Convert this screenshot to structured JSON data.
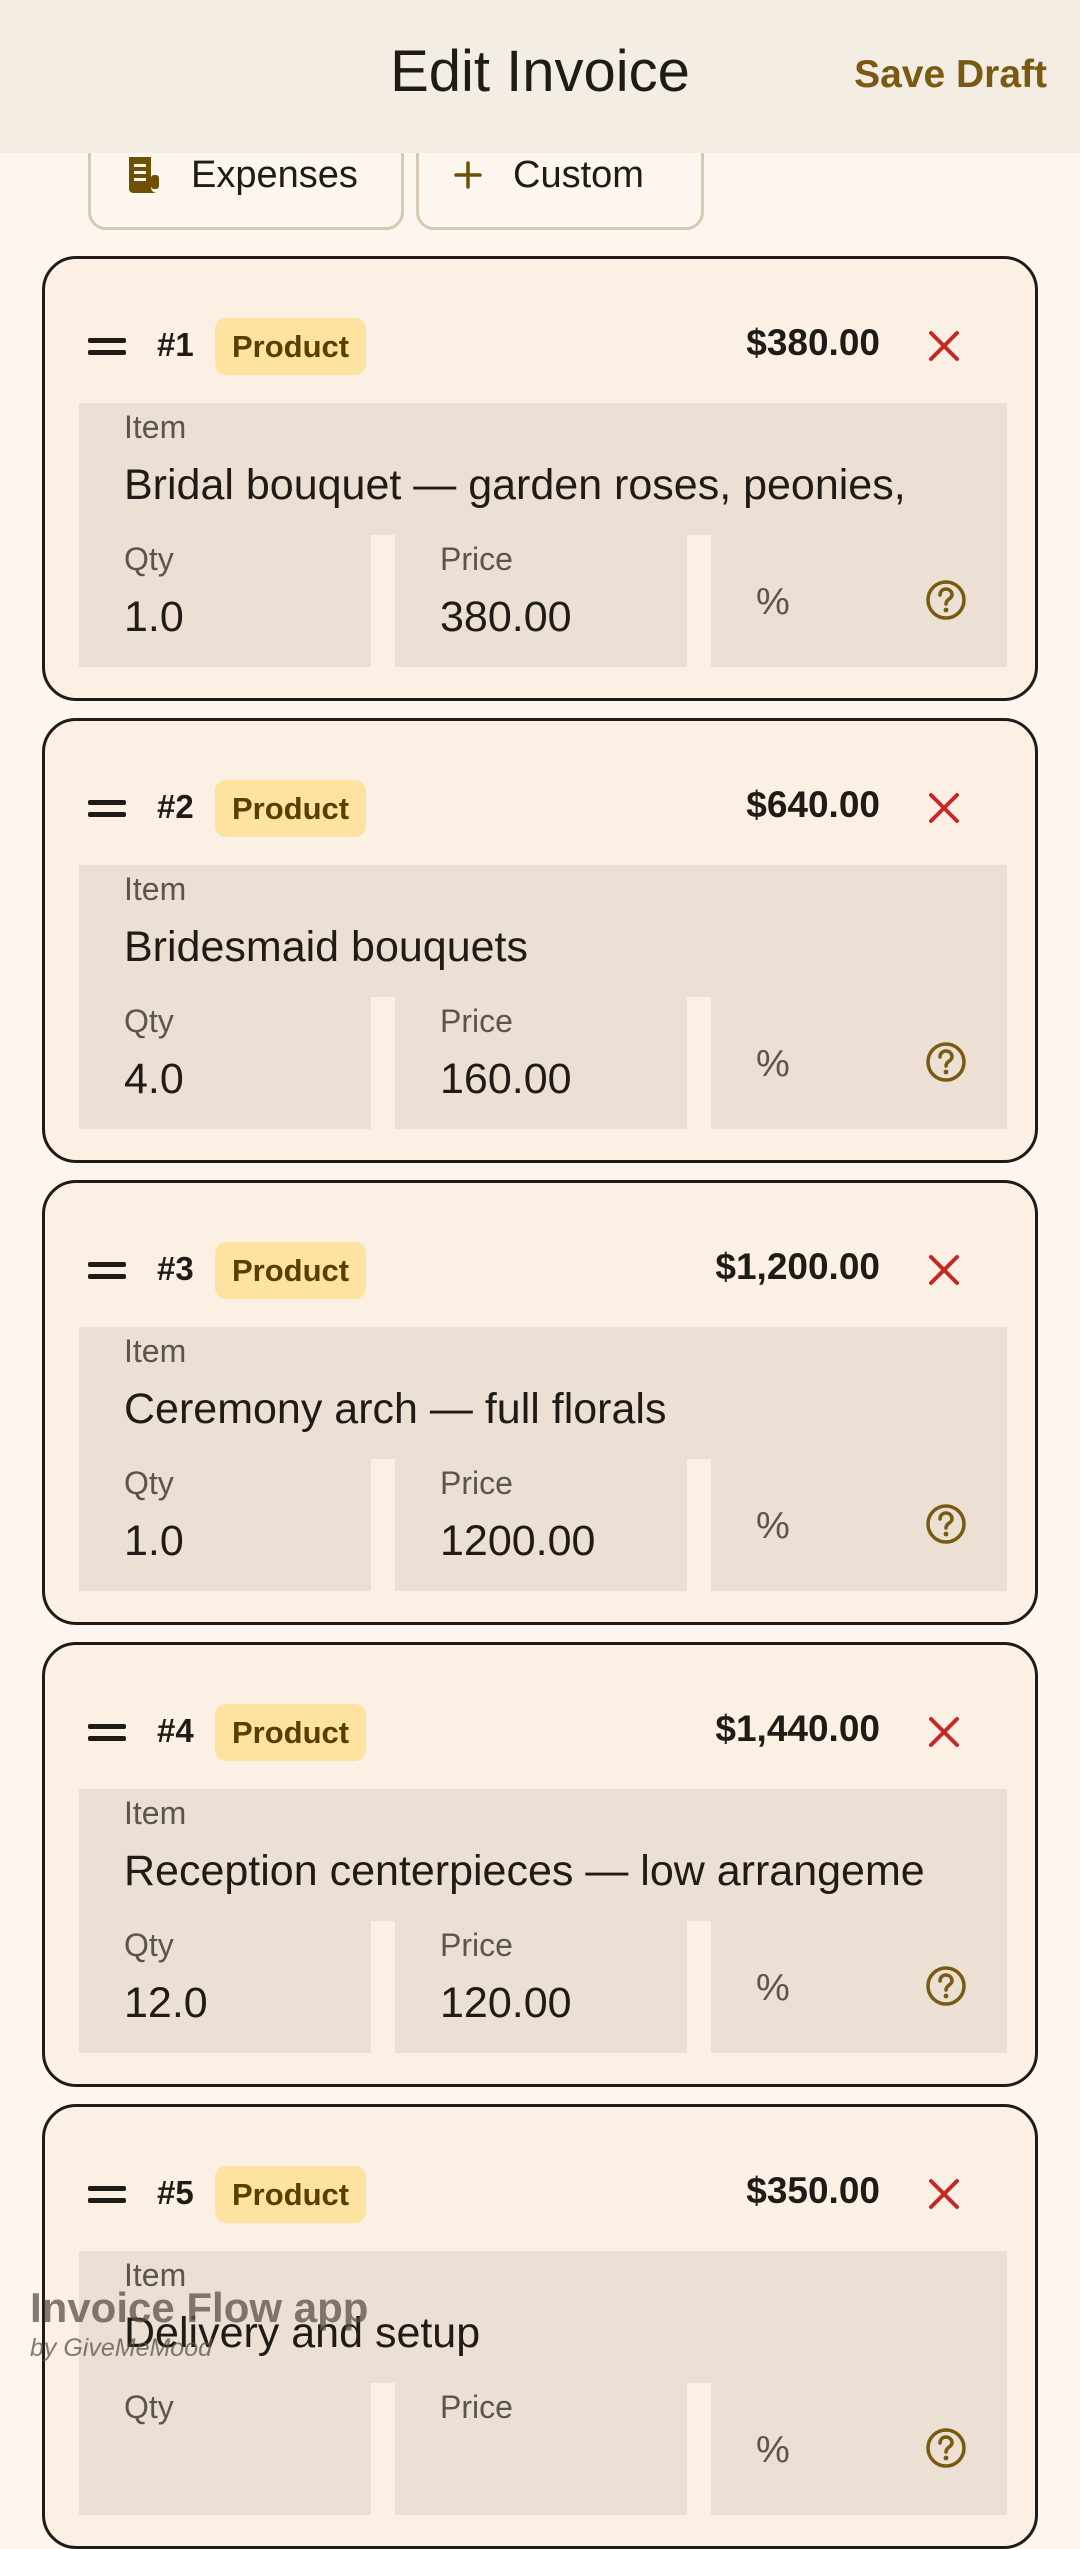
{
  "header": {
    "title": "Edit Invoice",
    "save_label": "Save Draft"
  },
  "chips": [
    {
      "label": "Expenses",
      "icon": "receipt-icon"
    },
    {
      "label": "Custom",
      "icon": "plus-icon"
    }
  ],
  "labels": {
    "item": "Item",
    "qty": "Qty",
    "price": "Price",
    "pct": "%"
  },
  "items": [
    {
      "number": "#1",
      "type": "Product",
      "total": "$380.00",
      "name": "Bridal bouquet — garden roses, peonies,",
      "qty": "1.0",
      "price": "380.00"
    },
    {
      "number": "#2",
      "type": "Product",
      "total": "$640.00",
      "name": "Bridesmaid bouquets",
      "qty": "4.0",
      "price": "160.00"
    },
    {
      "number": "#3",
      "type": "Product",
      "total": "$1,200.00",
      "name": "Ceremony arch — full florals",
      "qty": "1.0",
      "price": "1200.00"
    },
    {
      "number": "#4",
      "type": "Product",
      "total": "$1,440.00",
      "name": "Reception centerpieces — low arrangeme",
      "qty": "12.0",
      "price": "120.00"
    },
    {
      "number": "#5",
      "type": "Product",
      "total": "$350.00",
      "name": "Delivery and setup",
      "qty": "",
      "price": ""
    }
  ],
  "brand": {
    "name": "Invoice Flow app",
    "by": "by GiveMeMood"
  },
  "colors": {
    "accent": "#7a5a10",
    "badge_bg": "#fde3a0",
    "delete": "#c62828",
    "field_bg": "#ebe0d3",
    "card_bg": "#fcefe3"
  }
}
